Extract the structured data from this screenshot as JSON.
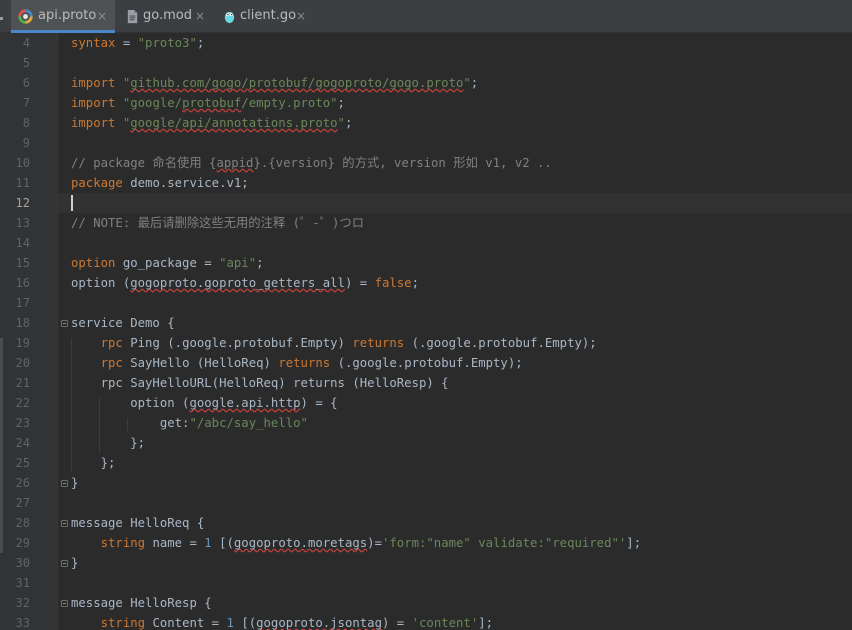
{
  "tabs": [
    {
      "label": "api.proto",
      "active": true,
      "icon": "proto-icon"
    },
    {
      "label": "go.mod",
      "active": false,
      "icon": "file-icon"
    },
    {
      "label": "client.go",
      "active": false,
      "icon": "go-gopher-icon"
    }
  ],
  "tab_close_glyph": "×",
  "editor": {
    "current_line": 12,
    "lines": [
      {
        "n": "4",
        "parts": [
          [
            "kw",
            "syntax"
          ],
          [
            "p",
            " = "
          ],
          [
            "str",
            "\"proto3\""
          ],
          [
            "p",
            ";"
          ]
        ]
      },
      {
        "n": "5",
        "parts": []
      },
      {
        "n": "6",
        "parts": [
          [
            "kw",
            "import "
          ],
          [
            "str",
            "\""
          ],
          [
            "strsq",
            "github.com/gogo/protobuf/gogoproto/gogo.proto"
          ],
          [
            "str",
            "\""
          ],
          [
            "p",
            ";"
          ]
        ]
      },
      {
        "n": "7",
        "parts": [
          [
            "kw",
            "import "
          ],
          [
            "str",
            "\"google/"
          ],
          [
            "strsq",
            "protobuf"
          ],
          [
            "str",
            "/empty.proto\""
          ],
          [
            "p",
            ";"
          ]
        ]
      },
      {
        "n": "8",
        "parts": [
          [
            "kw",
            "import "
          ],
          [
            "str",
            "\""
          ],
          [
            "strsq",
            "google/api/annotations.proto"
          ],
          [
            "str",
            "\""
          ],
          [
            "p",
            ";"
          ]
        ]
      },
      {
        "n": "9",
        "parts": []
      },
      {
        "n": "10",
        "parts": [
          [
            "cm",
            "// package 命名使用 {"
          ],
          [
            "cmsq",
            "appid"
          ],
          [
            "cm",
            "}.{version} 的方式, version 形如 v1, v2 .."
          ]
        ]
      },
      {
        "n": "11",
        "parts": [
          [
            "kw",
            "package "
          ],
          [
            "p",
            "demo.service.v1;"
          ]
        ]
      },
      {
        "n": "12",
        "parts": []
      },
      {
        "n": "13",
        "parts": [
          [
            "cm",
            "// NOTE: 最后请删除这些无用的注释 (゜-゜)つロ"
          ]
        ]
      },
      {
        "n": "14",
        "parts": []
      },
      {
        "n": "15",
        "parts": [
          [
            "kw",
            "option "
          ],
          [
            "p",
            "go_package = "
          ],
          [
            "str",
            "\"api\""
          ],
          [
            "p",
            ";"
          ]
        ]
      },
      {
        "n": "16",
        "parts": [
          [
            "p",
            "option ("
          ],
          [
            "psq",
            "gogoproto.goproto_getters_all"
          ],
          [
            "p",
            ") = "
          ],
          [
            "kw",
            "false"
          ],
          [
            "p",
            ";"
          ]
        ]
      },
      {
        "n": "17",
        "parts": []
      },
      {
        "n": "18",
        "parts": [
          [
            "p",
            "service Demo {"
          ]
        ]
      },
      {
        "n": "19",
        "parts": [
          [
            "p",
            "    "
          ],
          [
            "kw",
            "rpc "
          ],
          [
            "p",
            "Ping (.google.protobuf.Empty) "
          ],
          [
            "kw",
            "returns "
          ],
          [
            "p",
            "(.google.protobuf.Empty);"
          ]
        ]
      },
      {
        "n": "20",
        "parts": [
          [
            "p",
            "    "
          ],
          [
            "kw",
            "rpc "
          ],
          [
            "p",
            "SayHello (HelloReq) "
          ],
          [
            "kw",
            "returns "
          ],
          [
            "p",
            "(.google.protobuf.Empty);"
          ]
        ]
      },
      {
        "n": "21",
        "parts": [
          [
            "p",
            "    rpc SayHelloURL(HelloReq) returns (HelloResp) {"
          ]
        ]
      },
      {
        "n": "22",
        "parts": [
          [
            "p",
            "        option ("
          ],
          [
            "psq",
            "google.api.http"
          ],
          [
            "p",
            ") = {"
          ]
        ]
      },
      {
        "n": "23",
        "parts": [
          [
            "p",
            "            get:"
          ],
          [
            "str",
            "\"/abc/say_hello\""
          ]
        ]
      },
      {
        "n": "24",
        "parts": [
          [
            "p",
            "        };"
          ]
        ]
      },
      {
        "n": "25",
        "parts": [
          [
            "p",
            "    };"
          ]
        ]
      },
      {
        "n": "26",
        "parts": [
          [
            "p",
            "}"
          ]
        ]
      },
      {
        "n": "27",
        "parts": []
      },
      {
        "n": "28",
        "parts": [
          [
            "p",
            "message HelloReq {"
          ]
        ]
      },
      {
        "n": "29",
        "parts": [
          [
            "p",
            "    "
          ],
          [
            "kw",
            "string "
          ],
          [
            "p",
            "name = "
          ],
          [
            "num",
            "1 "
          ],
          [
            "p",
            "[("
          ],
          [
            "psq",
            "gogoproto.moretags"
          ],
          [
            "p",
            ")="
          ],
          [
            "str",
            "'form:\"name\" validate:\"required\"'"
          ],
          [
            "p",
            "];"
          ]
        ]
      },
      {
        "n": "30",
        "parts": [
          [
            "p",
            "}"
          ]
        ]
      },
      {
        "n": "31",
        "parts": []
      },
      {
        "n": "32",
        "parts": [
          [
            "p",
            "message HelloResp {"
          ]
        ]
      },
      {
        "n": "33",
        "parts": [
          [
            "p",
            "    "
          ],
          [
            "kw",
            "string "
          ],
          [
            "p",
            "Content = "
          ],
          [
            "num",
            "1 "
          ],
          [
            "p",
            "[("
          ],
          [
            "psq",
            "gogoproto.jsontag"
          ],
          [
            "p",
            ") = "
          ],
          [
            "str",
            "'content'"
          ],
          [
            "p",
            "];"
          ]
        ]
      }
    ],
    "fold_markers": [
      "18",
      "26",
      "28",
      "30",
      "32"
    ]
  },
  "colors": {
    "background": "#2b2b2b",
    "gutter": "#313335",
    "keyword": "#cc7832",
    "string": "#6a8759",
    "comment": "#808080",
    "number": "#6897bb",
    "text": "#a9b7c6",
    "tab_accent": "#4a88c7"
  }
}
